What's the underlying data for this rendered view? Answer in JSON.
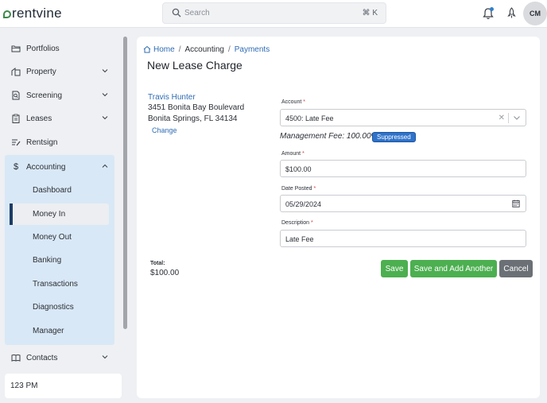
{
  "app": {
    "logo_text": "rentvine"
  },
  "header": {
    "search_placeholder": "Search",
    "search_shortcut": "⌘ K",
    "avatar_initials": "CM"
  },
  "sidebar": {
    "items": [
      {
        "label": "Portfolios",
        "icon": "folders-icon"
      },
      {
        "label": "Property",
        "icon": "building-icon"
      },
      {
        "label": "Screening",
        "icon": "screening-icon"
      },
      {
        "label": "Leases",
        "icon": "clipboard-icon"
      },
      {
        "label": "Rentsign",
        "icon": "signature-icon"
      },
      {
        "label": "Accounting",
        "icon": "dollar-icon"
      },
      {
        "label": "Contacts",
        "icon": "address-book-icon"
      }
    ],
    "accounting_sub": [
      "Dashboard",
      "Money In",
      "Money Out",
      "Banking",
      "Transactions",
      "Diagnostics",
      "Manager"
    ],
    "active_sub": "Money In",
    "time": "123 PM"
  },
  "breadcrumb": {
    "home": "Home",
    "section": "Accounting",
    "page": "Payments"
  },
  "page_title": "New Lease Charge",
  "tenant": {
    "name": "Travis Hunter",
    "address_line1": "3451 Bonita Bay Boulevard",
    "address_line2": "Bonita Springs, FL 34134",
    "change_label": "Change"
  },
  "form": {
    "account_label": "Account",
    "account_value": "4500: Late Fee",
    "management_fee": "Management Fee: 100.00%",
    "fee_badge": "Suppressed",
    "amount_label": "Amount",
    "amount_value": "$100.00",
    "date_label": "Date Posted",
    "date_value": "05/29/2024",
    "description_label": "Description",
    "description_value": "Late Fee",
    "required_mark": "*"
  },
  "totals": {
    "label": "Total:",
    "value": "$100.00"
  },
  "buttons": {
    "save": "Save",
    "save_add": "Save and Add Another",
    "cancel": "Cancel"
  },
  "colors": {
    "primary_green": "#4caf50",
    "link_blue": "#2f6cb3",
    "nav_active_bg": "#d9e8f6",
    "badge_blue": "#2f72c9"
  }
}
